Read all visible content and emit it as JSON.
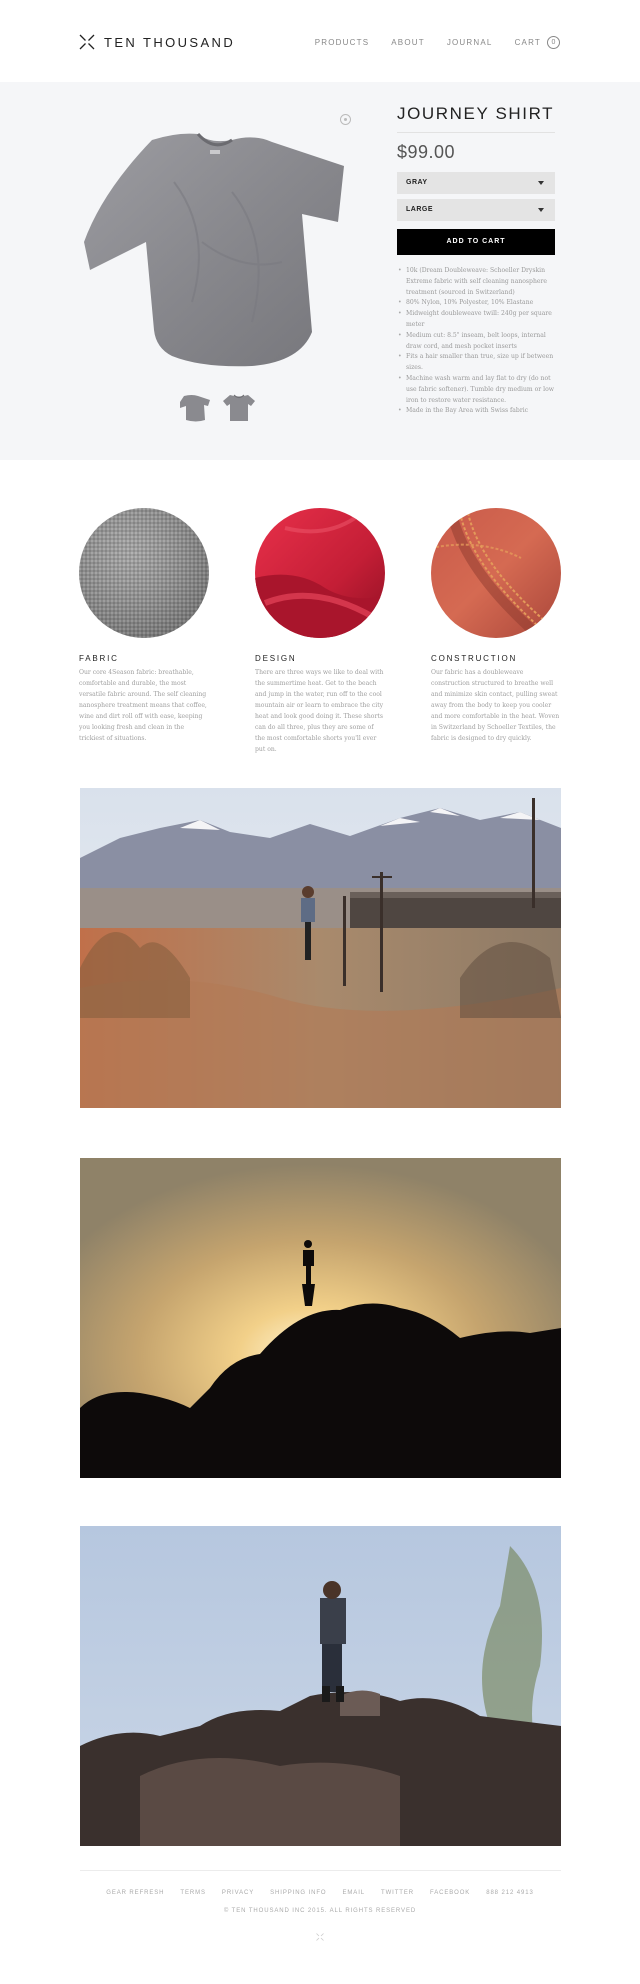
{
  "header": {
    "brand": "TEN THOUSAND",
    "logo_icon": "x-mark-icon",
    "nav": [
      "PRODUCTS",
      "ABOUT",
      "JOURNAL",
      "CART"
    ],
    "cart_count": "0"
  },
  "product": {
    "title": "JOURNEY SHIRT",
    "price": "$99.00",
    "color_select": "GRAY",
    "size_select": "LARGE",
    "add_to_cart": "ADD TO CART",
    "specs": [
      "10k (Dream Doubleweave: Schoeller Dryskin Extreme fabric with self cleaning nanosphere treatment (sourced in Switzerland)",
      "80% Nylon, 10% Polyester, 10% Elastane",
      "Midweight doubleweave twill: 240g per square meter",
      "Medium cut: 8.5\" inseam, belt loops, internal draw cord, and mesh pocket inserts",
      "Fits a hair smaller than true, size up if between sizes.",
      "Machine wash warm and lay flat to dry (do not use fabric softener). Tumble dry medium or low iron to restore water resistance.",
      "Made in the Bay Area with Swiss fabric"
    ],
    "colors": {
      "shirt": "#8d8d92",
      "accent_black": "#000000",
      "select_bg": "#e4e4e4"
    }
  },
  "features": [
    {
      "heading": "FABRIC",
      "text": "Our core 4Season fabric: breathable, comfortable and durable, the most versatile fabric around. The self cleaning nanosphere treatment means that coffee, wine and dirt roll off with ease, keeping you looking fresh and clean in the trickiest of situations."
    },
    {
      "heading": "DESIGN",
      "text": "There are three ways we like to deal with the summertime heat. Get to the beach and jump in the water, run off to the cool mountain air or learn to embrace the city heat and look good doing it. These shorts can do all three, plus they are some of the most comfortable shorts you'll ever put on."
    },
    {
      "heading": "CONSTRUCTION",
      "text": "Our fabric has a doubleweave construction structured to breathe well and minimize skin contact, pulling sweat away from the body to keep you cooler and more comfortable in the heat. Woven in Switzerland by Schoeller Textiles, the fabric is designed to dry quickly."
    }
  ],
  "footer": {
    "links": [
      "GEAR REFRESH",
      "TERMS",
      "PRIVACY",
      "SHIPPING INFO",
      "EMAIL",
      "TWITTER",
      "FACEBOOK",
      "888 212 4913"
    ],
    "copyright": "© TEN THOUSAND INC 2015. ALL RIGHTS RESERVED"
  }
}
